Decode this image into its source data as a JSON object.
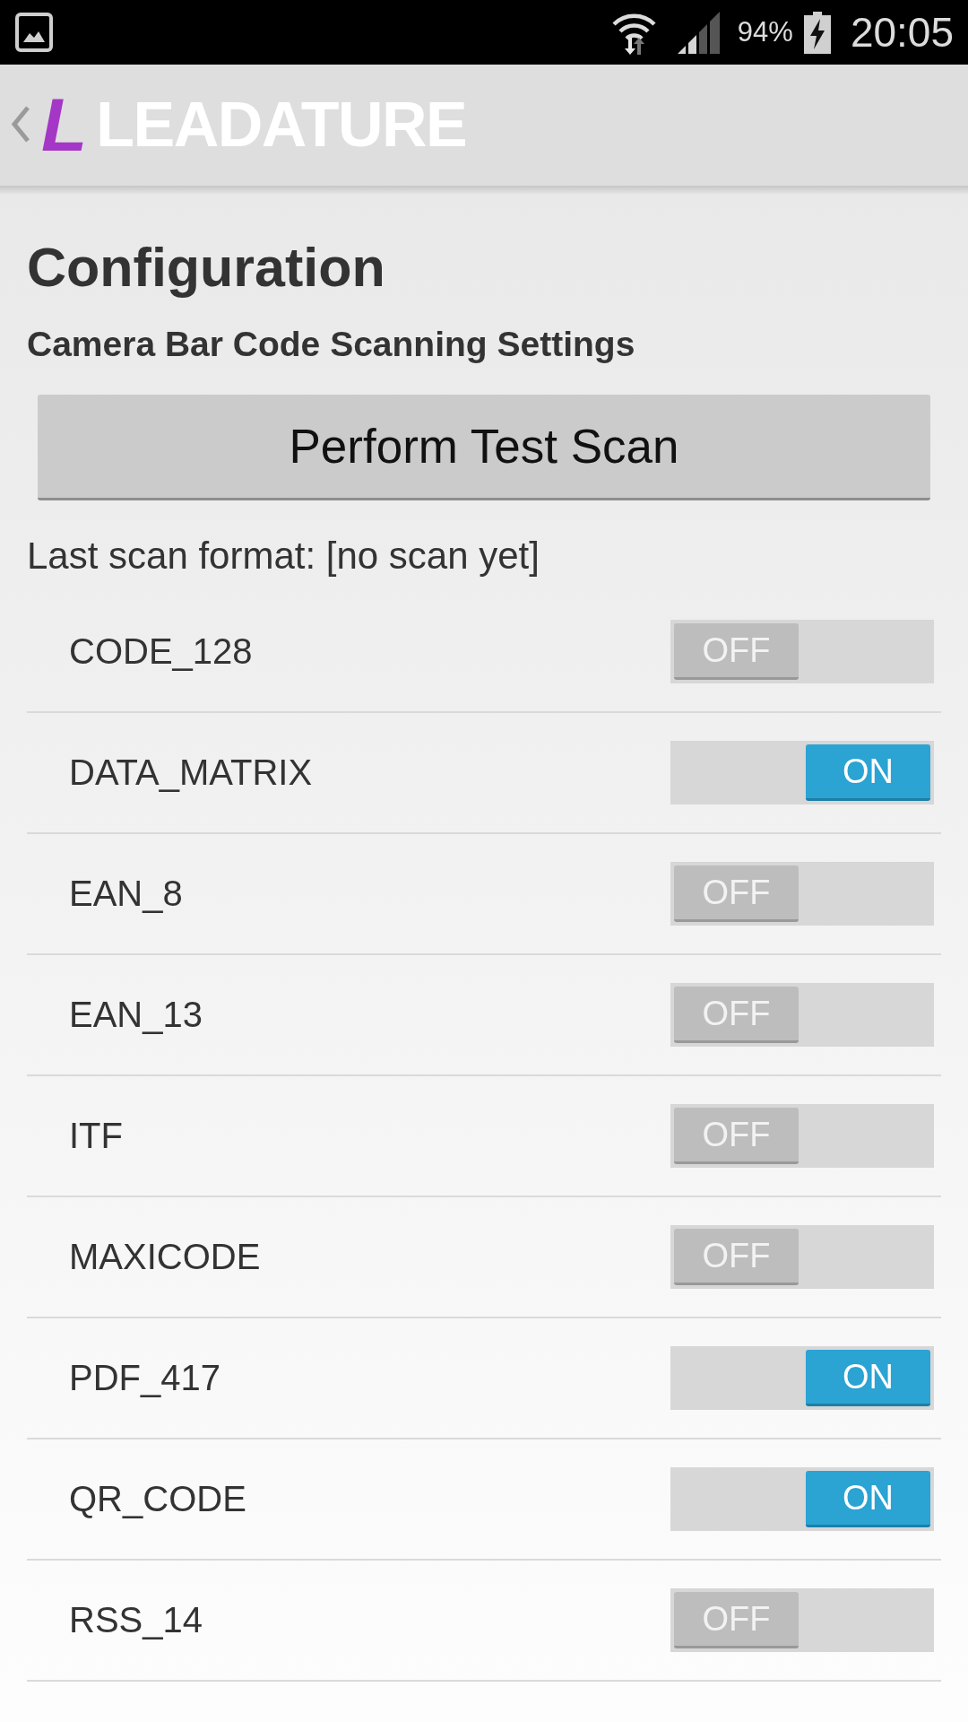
{
  "status_bar": {
    "battery_percent": "94%",
    "time": "20:05"
  },
  "app_bar": {
    "logo_mark": "L",
    "logo_text": "LEADATURE"
  },
  "configuration": {
    "title": "Configuration",
    "subtitle": "Camera Bar Code Scanning Settings",
    "test_scan_button": "Perform Test Scan",
    "last_scan_format": "Last scan format: [no scan yet]"
  },
  "barcode_formats": [
    {
      "name": "CODE_128",
      "on": false,
      "toggle_label": "OFF"
    },
    {
      "name": "DATA_MATRIX",
      "on": true,
      "toggle_label": "ON"
    },
    {
      "name": "EAN_8",
      "on": false,
      "toggle_label": "OFF"
    },
    {
      "name": "EAN_13",
      "on": false,
      "toggle_label": "OFF"
    },
    {
      "name": "ITF",
      "on": false,
      "toggle_label": "OFF"
    },
    {
      "name": "MAXICODE",
      "on": false,
      "toggle_label": "OFF"
    },
    {
      "name": "PDF_417",
      "on": true,
      "toggle_label": "ON"
    },
    {
      "name": "QR_CODE",
      "on": true,
      "toggle_label": "ON"
    },
    {
      "name": "RSS_14",
      "on": false,
      "toggle_label": "OFF"
    }
  ]
}
